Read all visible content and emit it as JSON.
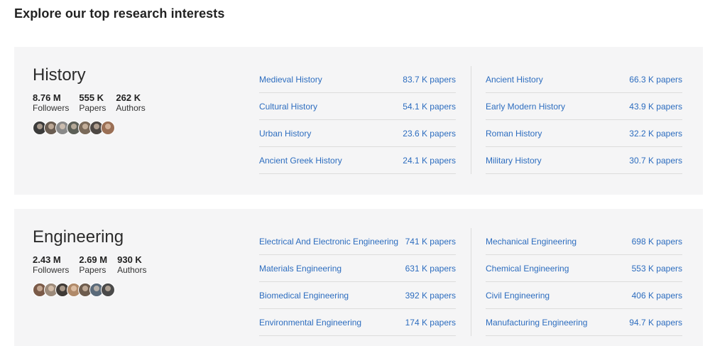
{
  "page": {
    "heading": "Explore our top research interests",
    "link_color": "#2d6dbf"
  },
  "topics": [
    {
      "title": "History",
      "stats": [
        {
          "value": "8.76 M",
          "label": "Followers"
        },
        {
          "value": "555 K",
          "label": "Papers"
        },
        {
          "value": "262 K",
          "label": "Authors"
        }
      ],
      "avatar_colors": [
        "#3b3b3b",
        "#6a5d52",
        "#8a8a8a",
        "#5c5f57",
        "#7a6a5a",
        "#4e4844",
        "#9a6f55"
      ],
      "left_column": [
        {
          "name": "Medieval History",
          "count": "83.7 K papers"
        },
        {
          "name": "Cultural History",
          "count": "54.1 K papers"
        },
        {
          "name": "Urban History",
          "count": "23.6 K papers"
        },
        {
          "name": "Ancient Greek History",
          "count": "24.1 K papers"
        }
      ],
      "right_column": [
        {
          "name": "Ancient History",
          "count": "66.3 K papers"
        },
        {
          "name": "Early Modern History",
          "count": "43.9 K papers"
        },
        {
          "name": "Roman History",
          "count": "32.2 K papers"
        },
        {
          "name": "Military History",
          "count": "30.7 K papers"
        }
      ]
    },
    {
      "title": "Engineering",
      "stats": [
        {
          "value": "2.43 M",
          "label": "Followers"
        },
        {
          "value": "2.69 M",
          "label": "Papers"
        },
        {
          "value": "930 K",
          "label": "Authors"
        }
      ],
      "avatar_colors": [
        "#7a5a48",
        "#9c8a7a",
        "#3f3a36",
        "#b08a6a",
        "#6d5c4e",
        "#5a6a7a",
        "#4a4a4a"
      ],
      "left_column": [
        {
          "name": "Electrical And Electronic Engineering",
          "count": "741 K papers"
        },
        {
          "name": "Materials Engineering",
          "count": "631 K papers"
        },
        {
          "name": "Biomedical Engineering",
          "count": "392 K papers"
        },
        {
          "name": "Environmental Engineering",
          "count": "174 K papers"
        }
      ],
      "right_column": [
        {
          "name": "Mechanical Engineering",
          "count": "698 K papers"
        },
        {
          "name": "Chemical Engineering",
          "count": "553 K papers"
        },
        {
          "name": "Civil Engineering",
          "count": "406 K papers"
        },
        {
          "name": "Manufacturing Engineering",
          "count": "94.7 K papers"
        }
      ]
    }
  ]
}
